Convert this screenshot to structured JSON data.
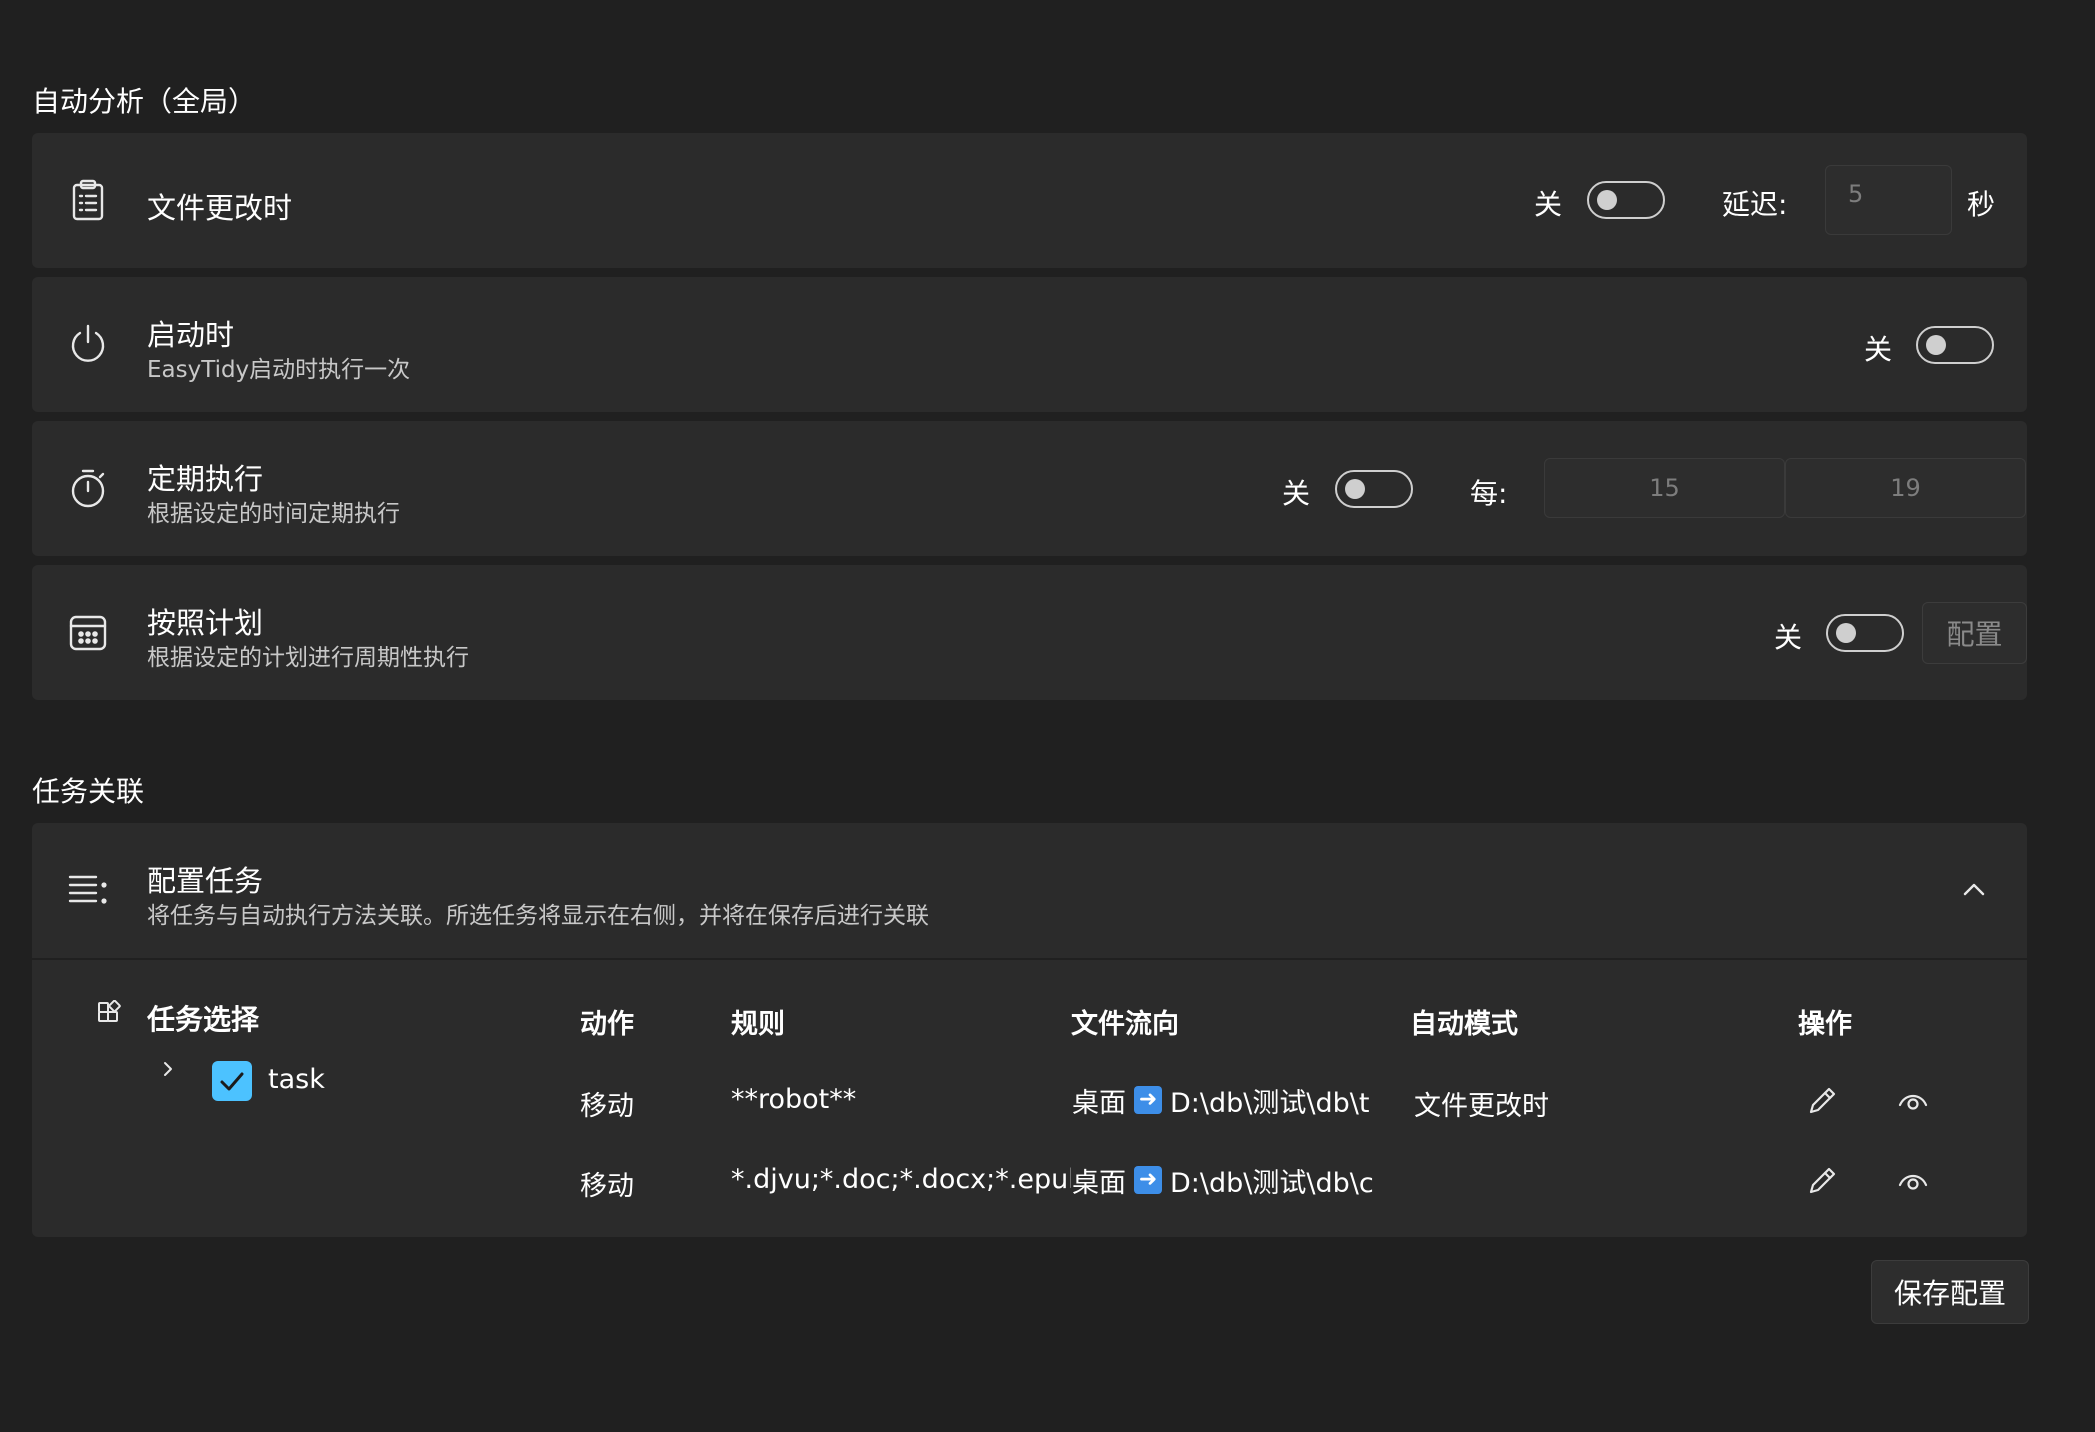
{
  "auto_analysis": {
    "section_title": "自动分析（全局）",
    "file_change": {
      "title": "文件更改时",
      "toggle_state": "关",
      "delay_label": "延迟:",
      "delay_value": "5",
      "delay_unit": "秒"
    },
    "on_startup": {
      "title": "启动时",
      "subtitle": "EasyTidy启动时执行一次",
      "toggle_state": "关"
    },
    "periodic": {
      "title": "定期执行",
      "subtitle": "根据设定的时间定期执行",
      "toggle_state": "关",
      "every_label": "每:",
      "value_1": "15",
      "value_2": "19"
    },
    "schedule": {
      "title": "按照计划",
      "subtitle": "根据设定的计划进行周期性执行",
      "toggle_state": "关",
      "configure_label": "配置"
    }
  },
  "task_link": {
    "section_title": "任务关联",
    "config_card": {
      "title": "配置任务",
      "subtitle": "将任务与自动执行方法关联。所选任务将显示在右侧，并将在保存后进行关联"
    },
    "task_select": {
      "header": "任务选择",
      "items": [
        {
          "label": "task",
          "checked": true
        }
      ]
    },
    "table": {
      "headers": {
        "action": "动作",
        "rule": "规则",
        "flow": "文件流向",
        "mode": "自动模式",
        "ops": "操作"
      },
      "rows": [
        {
          "action": "移动",
          "rule": "**robot**",
          "flow_from": "桌面",
          "flow_to": "D:\\db\\测试\\db\\t",
          "mode": "文件更改时"
        },
        {
          "action": "移动",
          "rule": "*.djvu;*.doc;*.docx;*.epub",
          "flow_from": "桌面",
          "flow_to": "D:\\db\\测试\\db\\c",
          "mode": ""
        }
      ]
    }
  },
  "save_button_label": "保存配置",
  "colors": {
    "background": "#202020",
    "card": "#2b2b2b",
    "accent": "#4cc2ff",
    "arrow_badge": "#3d8ee8"
  }
}
